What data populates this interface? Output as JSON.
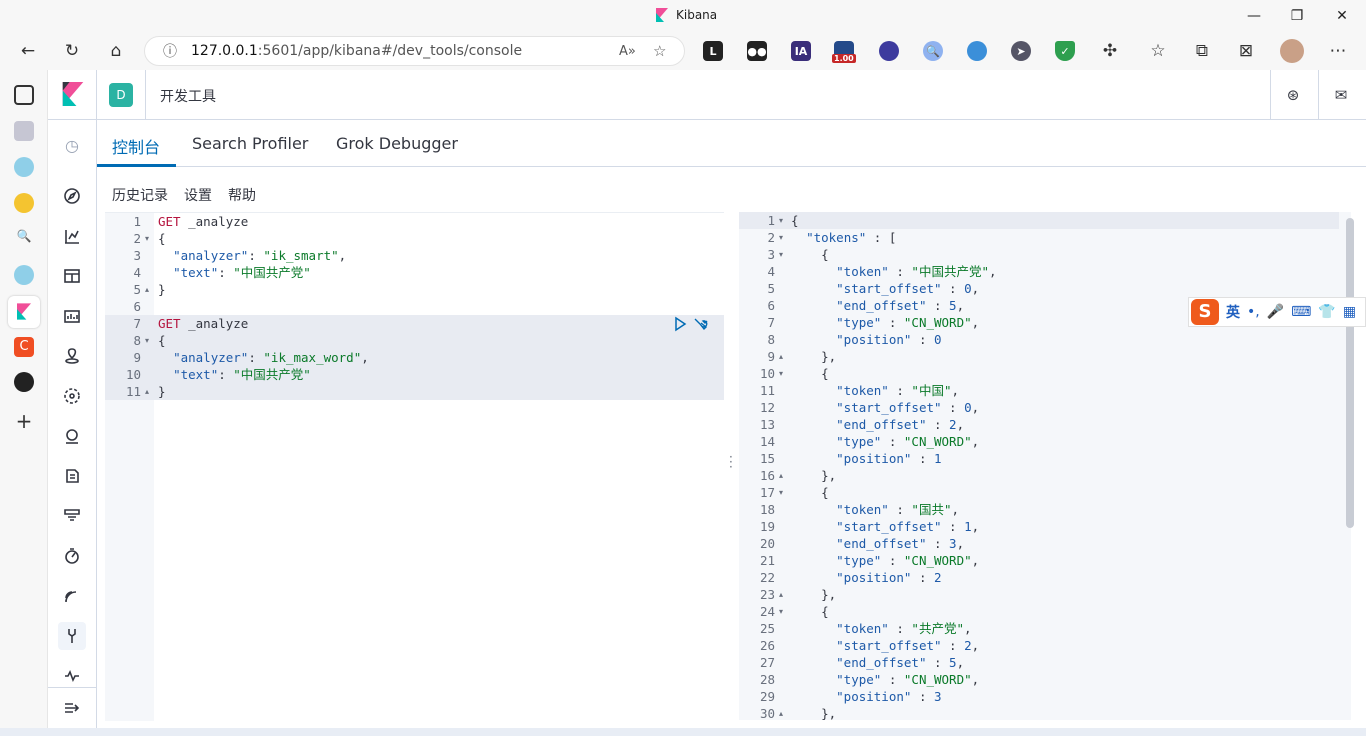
{
  "browser": {
    "tab_title": "Kibana",
    "url_host": "127.0.0.1",
    "url_rest": ":5601/app/kibana#/dev_tools/console",
    "ext_badge": "1.00",
    "ext_ia": "IA"
  },
  "kibana": {
    "space_letter": "D",
    "page_title": "开发工具",
    "tabs": [
      "控制台",
      "Search Profiler",
      "Grok Debugger"
    ],
    "sub_actions": [
      "历史记录",
      "设置",
      "帮助"
    ]
  },
  "ime": {
    "lang": "英"
  },
  "request_lines": [
    {
      "n": "1",
      "fold": "",
      "text": "GET _analyze"
    },
    {
      "n": "2",
      "fold": "▾",
      "text": "{"
    },
    {
      "n": "3",
      "fold": "",
      "text": "  \"analyzer\": \"ik_smart\","
    },
    {
      "n": "4",
      "fold": "",
      "text": "  \"text\": \"中国共产党\""
    },
    {
      "n": "5",
      "fold": "▴",
      "text": "}"
    },
    {
      "n": "6",
      "fold": "",
      "text": ""
    },
    {
      "n": "7",
      "fold": "",
      "text": "GET _analyze"
    },
    {
      "n": "8",
      "fold": "▾",
      "text": "{"
    },
    {
      "n": "9",
      "fold": "",
      "text": "  \"analyzer\": \"ik_max_word\","
    },
    {
      "n": "10",
      "fold": "",
      "text": "  \"text\": \"中国共产党\""
    },
    {
      "n": "11",
      "fold": "▴",
      "text": "}"
    }
  ],
  "response_lines": [
    {
      "n": "1",
      "fold": "▾",
      "text": "{"
    },
    {
      "n": "2",
      "fold": "▾",
      "text": "  \"tokens\" : ["
    },
    {
      "n": "3",
      "fold": "▾",
      "text": "    {"
    },
    {
      "n": "4",
      "fold": "",
      "text": "      \"token\" : \"中国共产党\","
    },
    {
      "n": "5",
      "fold": "",
      "text": "      \"start_offset\" : 0,"
    },
    {
      "n": "6",
      "fold": "",
      "text": "      \"end_offset\" : 5,"
    },
    {
      "n": "7",
      "fold": "",
      "text": "      \"type\" : \"CN_WORD\","
    },
    {
      "n": "8",
      "fold": "",
      "text": "      \"position\" : 0"
    },
    {
      "n": "9",
      "fold": "▴",
      "text": "    },"
    },
    {
      "n": "10",
      "fold": "▾",
      "text": "    {"
    },
    {
      "n": "11",
      "fold": "",
      "text": "      \"token\" : \"中国\","
    },
    {
      "n": "12",
      "fold": "",
      "text": "      \"start_offset\" : 0,"
    },
    {
      "n": "13",
      "fold": "",
      "text": "      \"end_offset\" : 2,"
    },
    {
      "n": "14",
      "fold": "",
      "text": "      \"type\" : \"CN_WORD\","
    },
    {
      "n": "15",
      "fold": "",
      "text": "      \"position\" : 1"
    },
    {
      "n": "16",
      "fold": "▴",
      "text": "    },"
    },
    {
      "n": "17",
      "fold": "▾",
      "text": "    {"
    },
    {
      "n": "18",
      "fold": "",
      "text": "      \"token\" : \"国共\","
    },
    {
      "n": "19",
      "fold": "",
      "text": "      \"start_offset\" : 1,"
    },
    {
      "n": "20",
      "fold": "",
      "text": "      \"end_offset\" : 3,"
    },
    {
      "n": "21",
      "fold": "",
      "text": "      \"type\" : \"CN_WORD\","
    },
    {
      "n": "22",
      "fold": "",
      "text": "      \"position\" : 2"
    },
    {
      "n": "23",
      "fold": "▴",
      "text": "    },"
    },
    {
      "n": "24",
      "fold": "▾",
      "text": "    {"
    },
    {
      "n": "25",
      "fold": "",
      "text": "      \"token\" : \"共产党\","
    },
    {
      "n": "26",
      "fold": "",
      "text": "      \"start_offset\" : 2,"
    },
    {
      "n": "27",
      "fold": "",
      "text": "      \"end_offset\" : 5,"
    },
    {
      "n": "28",
      "fold": "",
      "text": "      \"type\" : \"CN_WORD\","
    },
    {
      "n": "29",
      "fold": "",
      "text": "      \"position\" : 3"
    },
    {
      "n": "30",
      "fold": "▴",
      "text": "    },"
    }
  ]
}
